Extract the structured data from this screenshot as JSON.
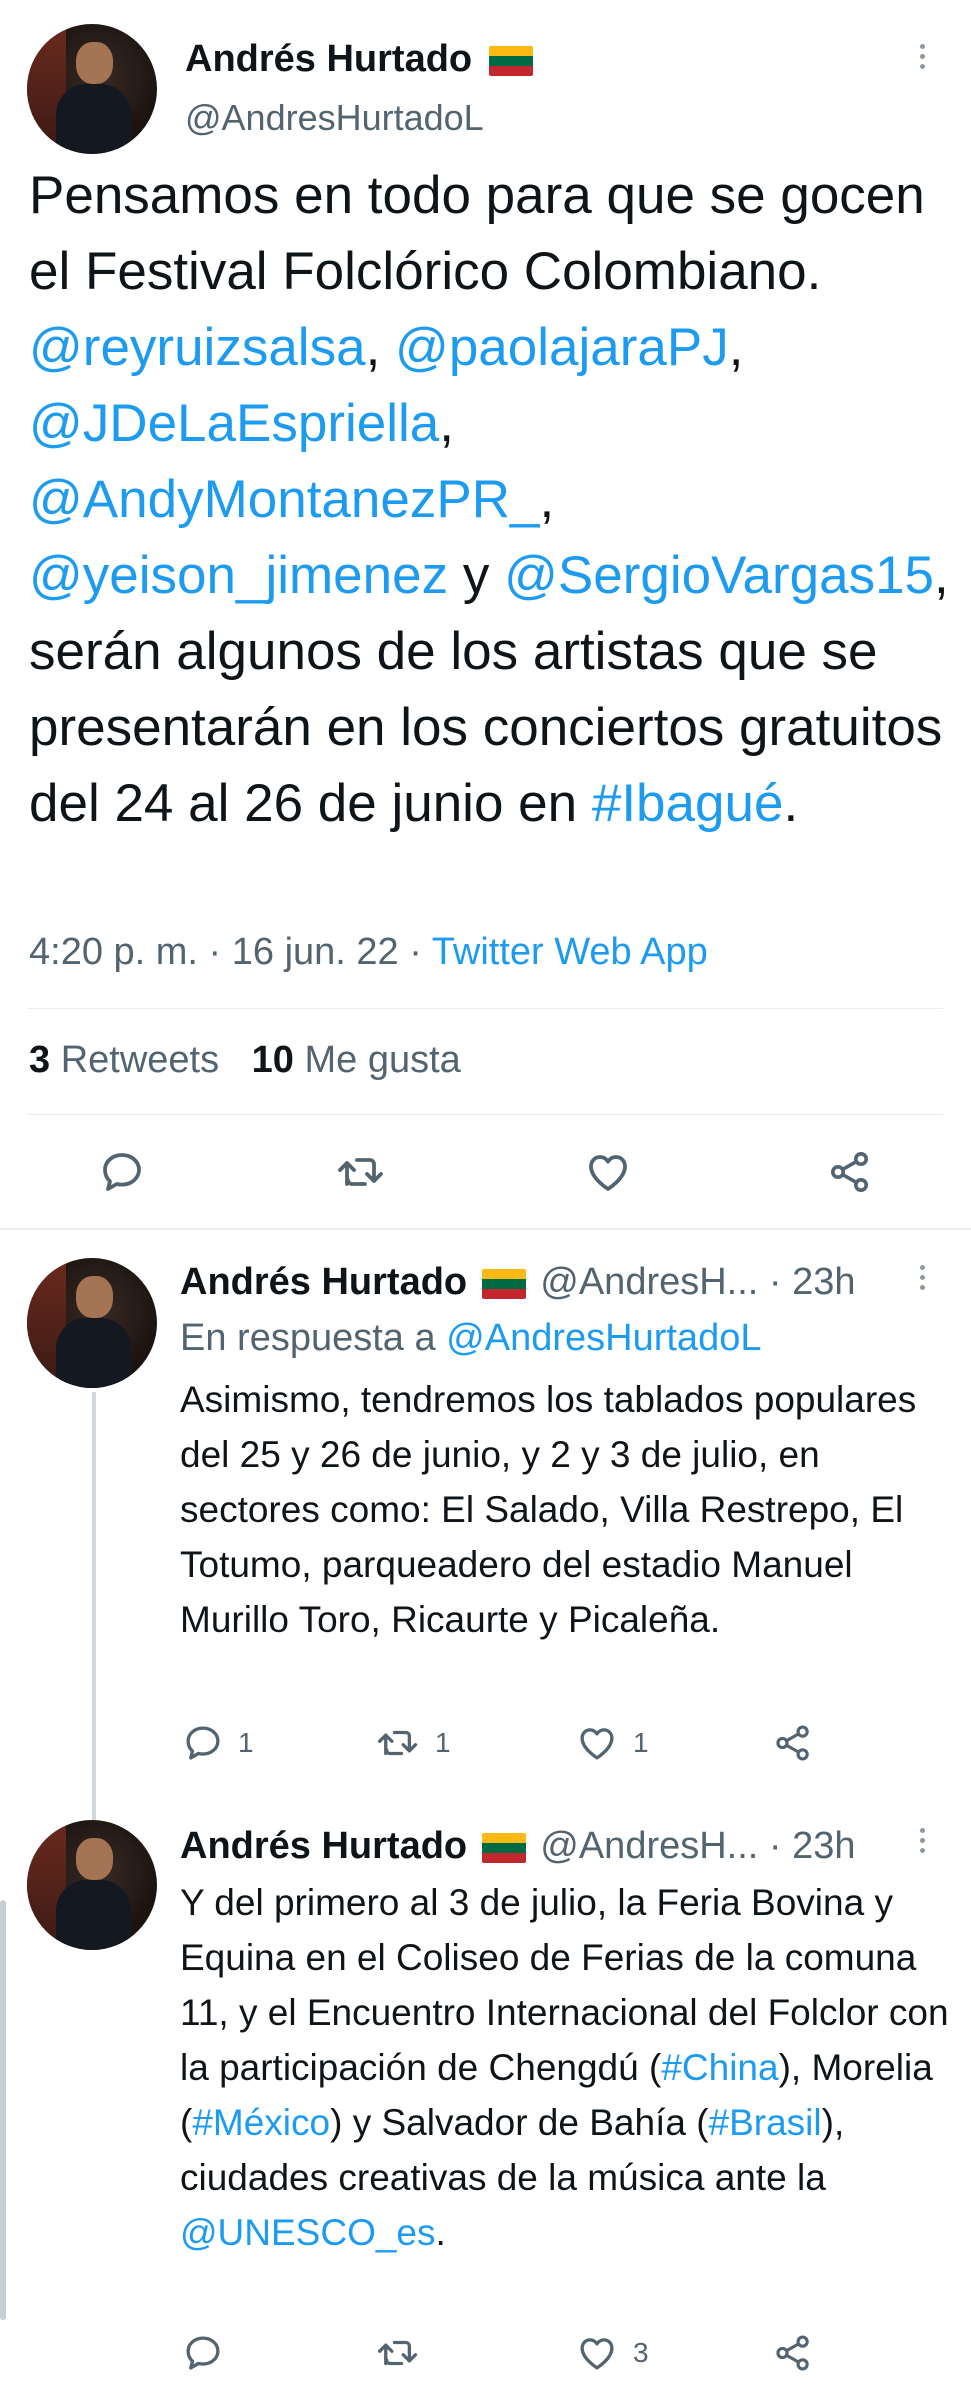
{
  "main_tweet": {
    "author_name": "Andrés Hurtado",
    "handle": "@AndresHurtadoL",
    "text_parts": [
      {
        "t": "Pensamos en todo para que se gocen el Festival Folclórico Colombiano. ",
        "link": false
      },
      {
        "t": "@reyruizsalsa",
        "link": true
      },
      {
        "t": ", ",
        "link": false
      },
      {
        "t": "@paolajaraPJ",
        "link": true
      },
      {
        "t": ", ",
        "link": false
      },
      {
        "t": "@JDeLaEspriella",
        "link": true
      },
      {
        "t": ", ",
        "link": false
      },
      {
        "t": "@AndyMontanezPR_",
        "link": true
      },
      {
        "t": ", ",
        "link": false
      },
      {
        "t": "@yeison_jimenez",
        "link": true
      },
      {
        "t": " y ",
        "link": false
      },
      {
        "t": "@SergioVargas15",
        "link": true
      },
      {
        "t": ", serán algunos de los artistas que se presentarán en los conciertos gratuitos del 24 al 26 de junio en ",
        "link": false
      },
      {
        "t": "#Ibagué",
        "link": true
      },
      {
        "t": ".",
        "link": false
      }
    ],
    "time": "4:20 p. m.",
    "sep1": "·",
    "date": "16 jun. 22",
    "sep2": "·",
    "source": "Twitter Web App",
    "retweets_count": "3",
    "retweets_label": "Retweets",
    "likes_count": "10",
    "likes_label": "Me gusta"
  },
  "reply1": {
    "author_name": "Andrés Hurtado",
    "handle": "@AndresH...",
    "sep": "·",
    "time": "23h",
    "in_reply_prefix": "En respuesta a",
    "in_reply_handle": "@AndresHurtadoL",
    "text": "Asimismo, tendremos los tablados populares del 25 y 26 de junio, y 2 y 3 de julio, en sectores como: El Salado, Villa Restrepo, El Totumo, parqueadero del estadio Manuel Murillo Toro, Ricaurte y Picaleña.",
    "reply_count": "1",
    "retweet_count": "1",
    "like_count": "1"
  },
  "reply2": {
    "author_name": "Andrés Hurtado",
    "handle": "@AndresH...",
    "sep": "·",
    "time": "23h",
    "text_parts": [
      {
        "t": "Y del primero al 3 de julio, la Feria Bovina y Equina en el Coliseo de Ferias de la comuna 11, y el Encuentro Internacional del Folclor con la participación de Chengdú (",
        "link": false
      },
      {
        "t": "#China",
        "link": true
      },
      {
        "t": "), Morelia (",
        "link": false
      },
      {
        "t": "#México",
        "link": true
      },
      {
        "t": ") y Salvador de Bahía (",
        "link": false
      },
      {
        "t": "#Brasil",
        "link": true
      },
      {
        "t": "), ciudades creativas de la música ante la ",
        "link": false
      },
      {
        "t": "@UNESCO_es",
        "link": true
      },
      {
        "t": ".",
        "link": false
      }
    ],
    "like_count": "3"
  },
  "icons": {
    "reply": "reply-icon",
    "retweet": "retweet-icon",
    "like": "heart-icon",
    "share": "share-icon",
    "more": "more-icon",
    "flag": "lithuania-flag-icon"
  },
  "colors": {
    "link": "#1d9bf0",
    "muted": "#536471",
    "text": "#0f1419",
    "divider": "#e6ecf0",
    "flag_yellow": "#fdb913",
    "flag_green": "#006a44",
    "flag_red": "#c1272d"
  }
}
